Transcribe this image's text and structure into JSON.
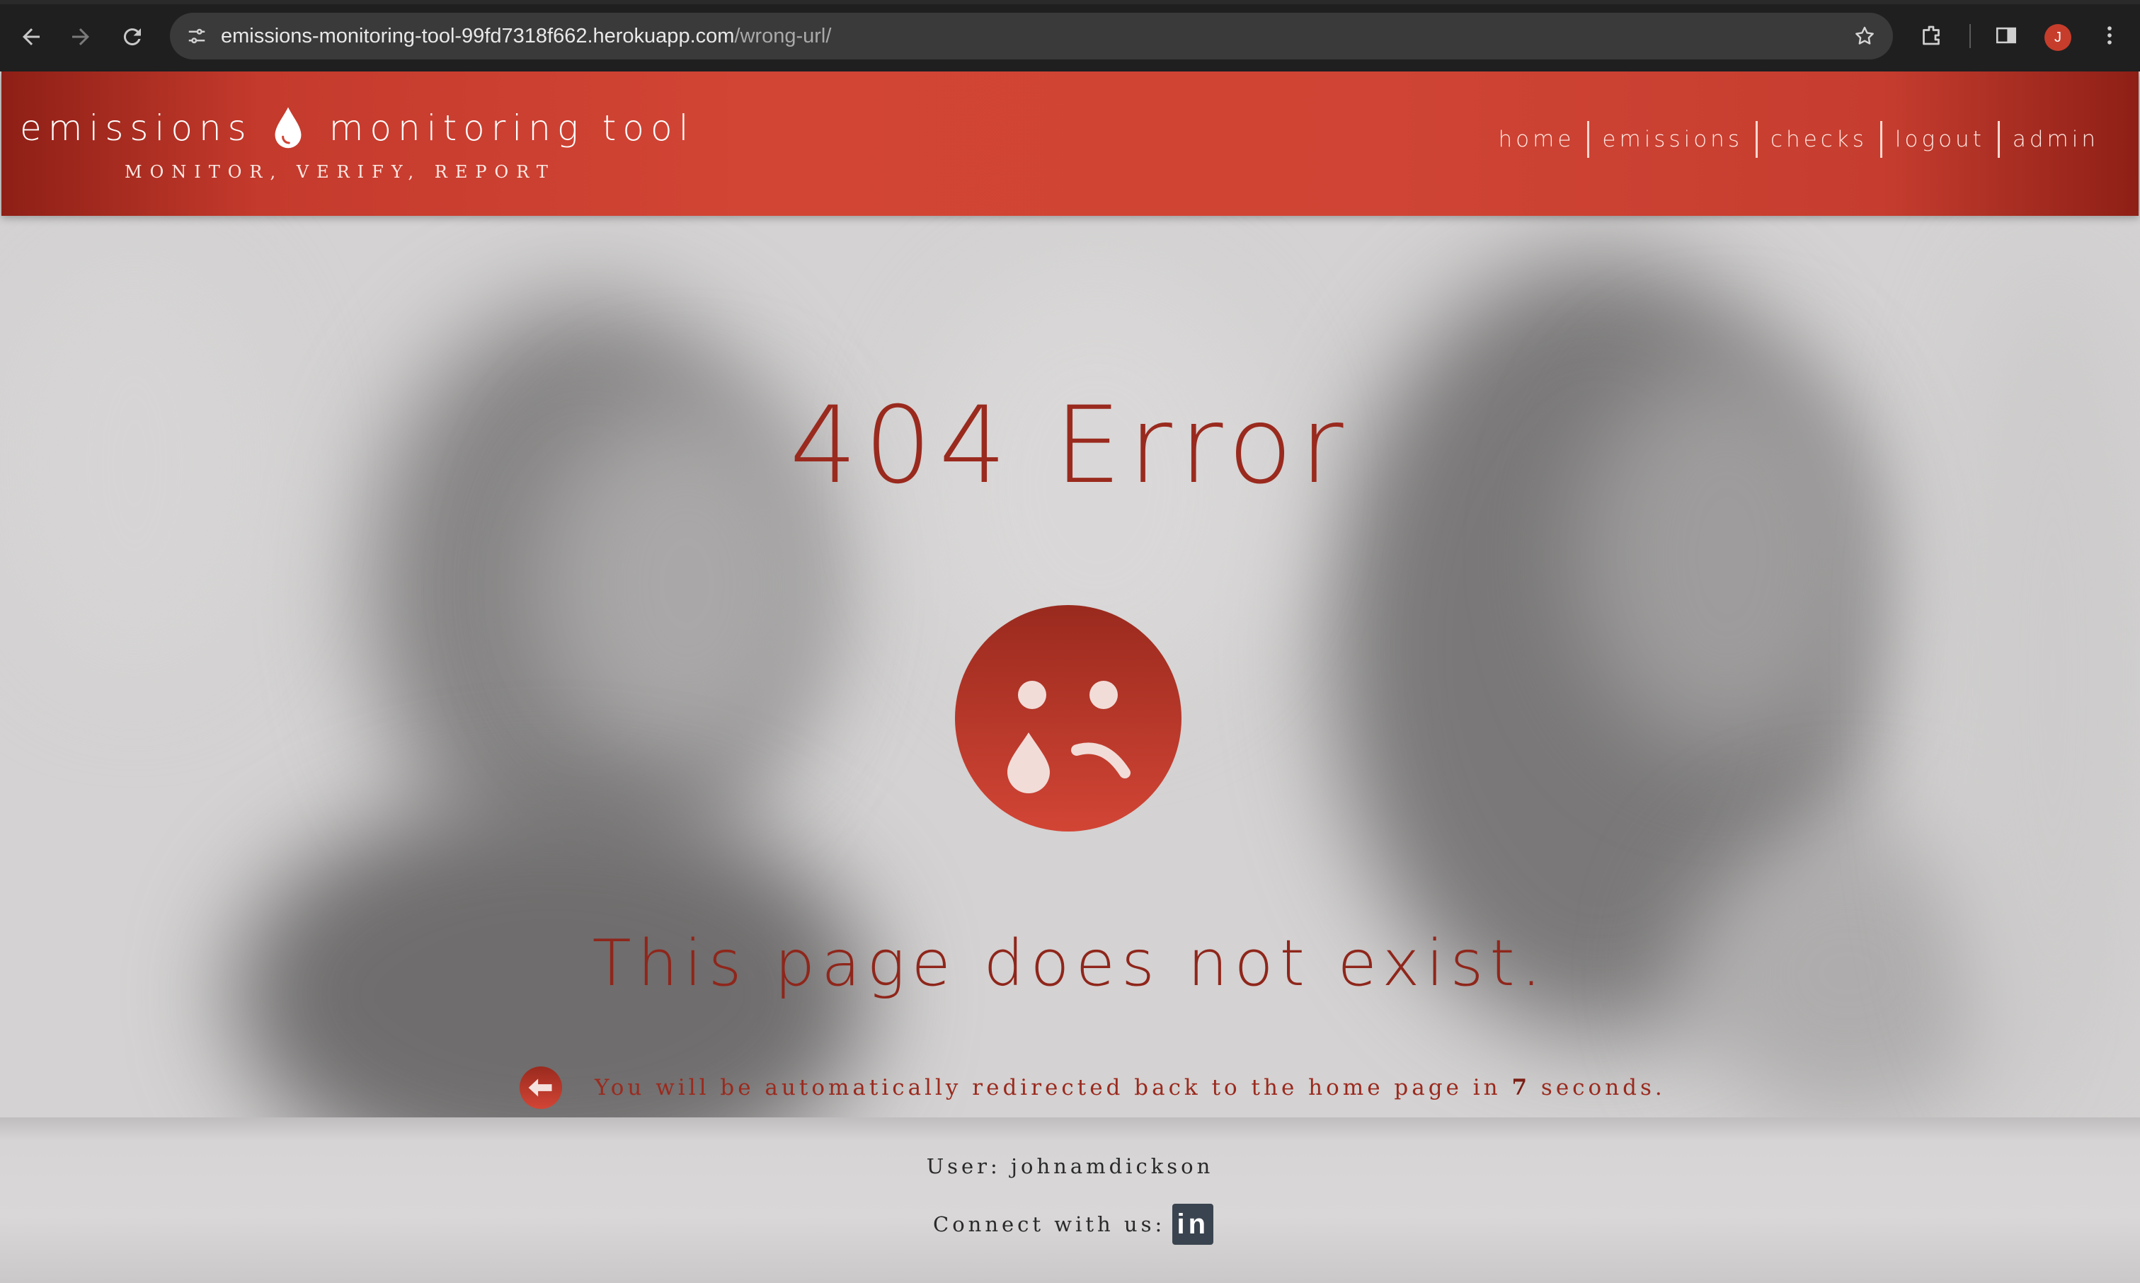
{
  "browser": {
    "url_host": "emissions-monitoring-tool-99fd7318f662.herokuapp.com",
    "url_path": "/wrong-url/",
    "profile_initial": "J"
  },
  "header": {
    "brand_left": "emissions",
    "brand_right": "monitoring tool",
    "tagline": "MONITOR, VERIFY, REPORT",
    "nav": {
      "home": "home",
      "emissions": "emissions",
      "checks": "checks",
      "logout": "logout",
      "admin": "admin"
    }
  },
  "main": {
    "title": "404 Error",
    "message": "This page does not exist.",
    "redirect_before": "You will be automatically redirected back to the home page in ",
    "redirect_count": "7",
    "redirect_after": " seconds."
  },
  "footer": {
    "user_text": "User: johnamdickson",
    "connect_text": "Connect with us:",
    "linkedin_label": "in"
  },
  "colors": {
    "brand_red": "#d24535",
    "dark_red": "#9a2a1e"
  }
}
